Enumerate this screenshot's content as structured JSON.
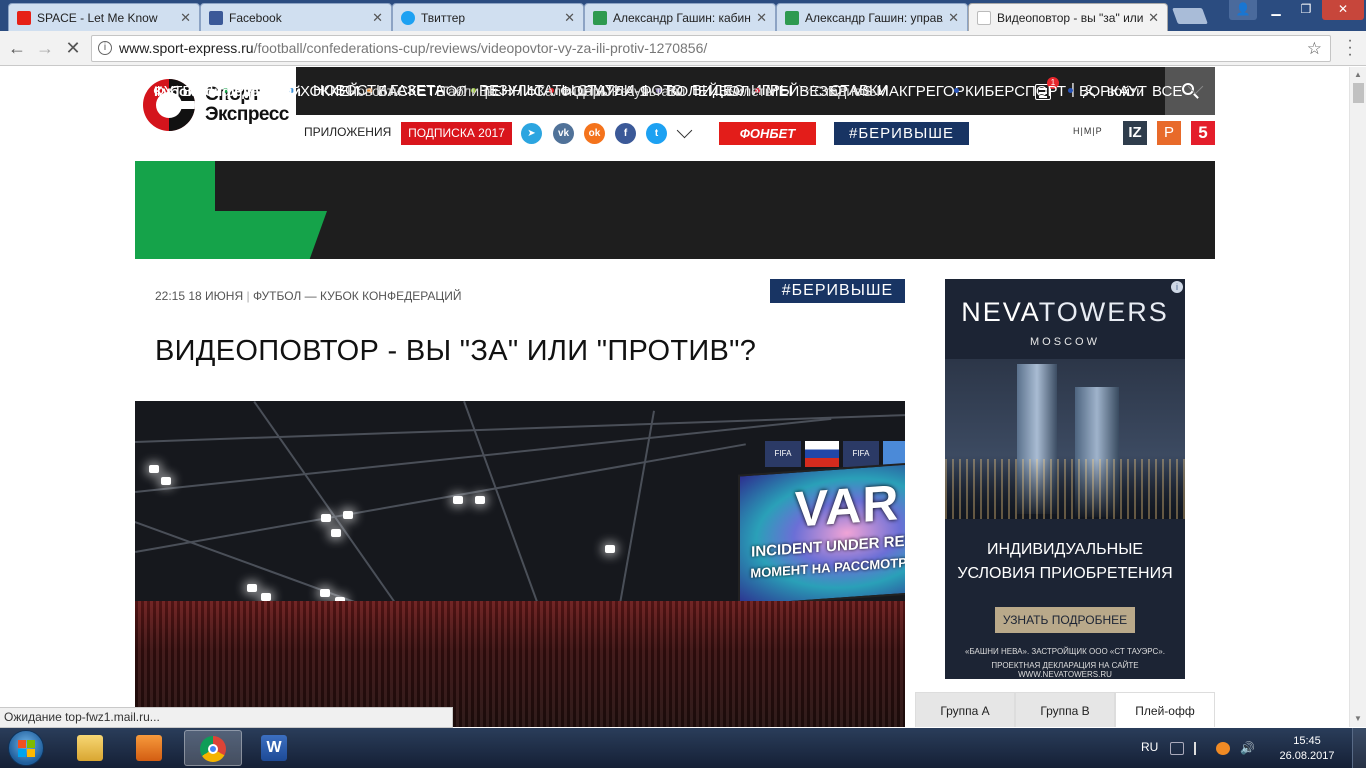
{
  "browser": {
    "tabs": [
      {
        "title": "SPACE - Let Me Know",
        "icon": "youtube-icon",
        "color": "#e62117",
        "active": false
      },
      {
        "title": "Facebook",
        "icon": "facebook-icon",
        "color": "#3b5998",
        "active": false
      },
      {
        "title": "Твиттер",
        "icon": "twitter-icon",
        "color": "#1da1f2",
        "active": false
      },
      {
        "title": "Александр Гашин: кабинет",
        "icon": "sheets-icon",
        "color": "#2e9a4f",
        "active": false
      },
      {
        "title": "Александр Гашин: управление",
        "icon": "sheets-icon",
        "color": "#2e9a4f",
        "active": false
      },
      {
        "title": "Видеоповтор - вы \"за\" или",
        "icon": "page-icon",
        "color": "#dddddd",
        "active": true
      }
    ],
    "url_host": "www.sport-express.ru",
    "url_path": "/football/confederations-cup/reviews/videopovtor-vy-za-ili-protiv-1270856/",
    "status": "Ожидание top-fwz1.mail.ru..."
  },
  "site": {
    "logo_line1": "Спорт",
    "logo_line2": "Экспресс",
    "main_nav": [
      "НОВОСТИ",
      "ГАЗЕТА",
      "РЕЗУЛЬТАТЫ",
      "СТАТЬИ",
      "ФОТО",
      "ВИДЕО",
      "ИГРЫ",
      "СТАВКИ"
    ],
    "notif_count": "1",
    "login": "войти",
    "apps_label": "ПРИЛОЖЕНИЯ",
    "subscribe": "ПОДПИСКА 2017",
    "social": [
      {
        "icon": "telegram-icon",
        "glyph": "➤",
        "color": "#2ca5e0"
      },
      {
        "icon": "vk-icon",
        "glyph": "vk",
        "color": "#507299"
      },
      {
        "icon": "odnoklassniki-icon",
        "glyph": "ok",
        "color": "#f4731c"
      },
      {
        "icon": "facebook-icon",
        "glyph": "f",
        "color": "#3b5998"
      },
      {
        "icon": "twitter-icon",
        "glyph": "t",
        "color": "#1da1f2"
      }
    ],
    "fonbet": "ФОНБЕТ",
    "hashtag": "#БЕРИВЫШЕ",
    "partner_nmr": "Н|М|Р",
    "partner_iz": "IZ",
    "partner_ren": "Р",
    "partner_5": "5",
    "sport_nav": [
      {
        "label": "ФУТБОЛ",
        "dot": "#ffffff"
      },
      {
        "label": "РФПЛ",
        "dot": "#15a34a"
      },
      {
        "label": "ХОККЕЙ",
        "dot": "#3b8fd6"
      },
      {
        "label": "БАСКЕТБОЛ",
        "dot": "#f08a24"
      },
      {
        "label": "ТЕННИС",
        "dot": "#9bc53d"
      },
      {
        "label": "ФОРМУЛА-1",
        "dot": "#e8262c"
      },
      {
        "label": "ВОЛЕЙБОЛ",
        "dot": "#8b7bb8"
      },
      {
        "label": "МЕЙВЕЗЕР VS МАКГРЕГОР",
        "dot": "#d6263c"
      },
      {
        "label": "КИБЕРСПОРТ",
        "dot": "#2854b8"
      },
      {
        "label": "ВОРКАУТ",
        "dot": "#2854b8"
      },
      {
        "label": "ВСЕ",
        "dot": ""
      }
    ],
    "sub_nav_title": "Кубок конфедераций",
    "sub_nav": [
      "Новости",
      "Таблицы",
      "Календарь/Результаты",
      "Билеты",
      "Стадионы"
    ],
    "accent_green": "#15a34a"
  },
  "article": {
    "datetime": "22:15 18 ИЮНЯ",
    "category": "ФУТБОЛ — КУБОК КОНФЕДЕРАЦИЙ",
    "title": "ВИДЕОПОВТОР - ВЫ \"ЗА\" ИЛИ \"ПРОТИВ\"?",
    "photo_var": "VAR",
    "photo_line1": "INCIDENT UNDER REVIEW",
    "photo_line2": "МОМЕНТ НА РАССМОТРЕНИИ",
    "photo_flag1": "FIFA",
    "photo_flag2": "FIFA"
  },
  "ad": {
    "brand_a": "NEVA",
    "brand_b": "TOWERS",
    "city": "MOSCOW",
    "line1": "ИНДИВИДУАЛЬНЫЕ",
    "line2": "УСЛОВИЯ ПРИОБРЕТЕНИЯ",
    "button": "УЗНАТЬ ПОДРОБНЕЕ",
    "foot1": "«БАШНИ НЕВА». ЗАСТРОЙЩИК ООО «СТ ТАУЭРС».",
    "foot2": "ПРОЕКТНАЯ ДЕКЛАРАЦИЯ НА САЙТЕ WWW.NEVATOWERS.RU",
    "info": "i"
  },
  "groups": [
    "Группа А",
    "Группа B",
    "Плей-офф"
  ],
  "taskbar": {
    "lang": "RU",
    "time": "15:45",
    "date": "26.08.2017"
  }
}
